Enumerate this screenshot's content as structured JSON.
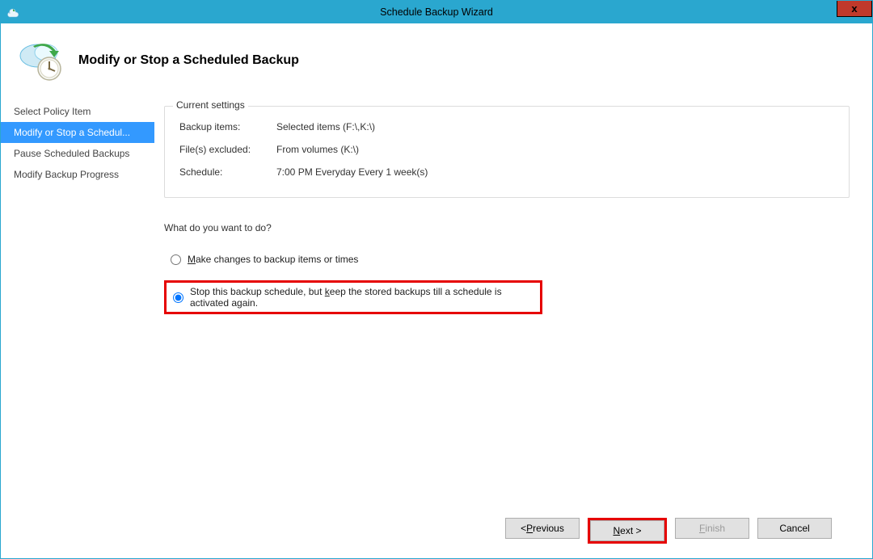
{
  "window": {
    "title": "Schedule Backup Wizard",
    "close_label": "x"
  },
  "header": {
    "heading": "Modify or Stop a Scheduled Backup"
  },
  "sidebar": {
    "items": [
      {
        "label": "Select Policy Item"
      },
      {
        "label": "Modify or Stop a Schedul..."
      },
      {
        "label": "Pause Scheduled Backups"
      },
      {
        "label": "Modify Backup Progress"
      }
    ],
    "selected_index": 1
  },
  "content": {
    "groupbox_legend": "Current settings",
    "rows": [
      {
        "k": "Backup items:",
        "v": "Selected items (F:\\,K:\\)"
      },
      {
        "k": "File(s) excluded:",
        "v": "From volumes (K:\\)"
      },
      {
        "k": "Schedule:",
        "v": "7:00 PM Everyday Every 1 week(s)"
      }
    ],
    "question": "What do you want to do?",
    "radios": {
      "option1_pre": "",
      "option1_u": "M",
      "option1_post": "ake changes to backup items or times",
      "option2_pre": "Stop this backup schedule, but ",
      "option2_u": "k",
      "option2_post": "eep the stored backups till a schedule is activated again.",
      "selected": "option2"
    }
  },
  "buttons": {
    "previous_pre": "< ",
    "previous_u": "P",
    "previous_post": "revious",
    "next_u": "N",
    "next_post": "ext >",
    "finish_u": "F",
    "finish_post": "inish",
    "cancel": "Cancel"
  }
}
